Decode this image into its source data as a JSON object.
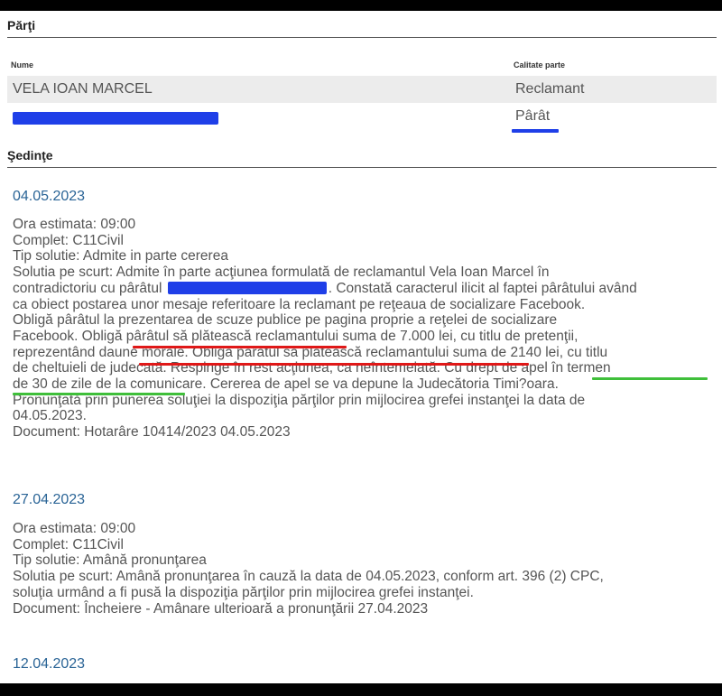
{
  "parti": {
    "title": "Părţi",
    "col_nume": "Nume",
    "col_calitate": "Calitate parte",
    "rows": [
      {
        "nume": "VELA IOAN MARCEL",
        "calitate": "Reclamant"
      },
      {
        "nume": "",
        "calitate": "Pârât"
      }
    ]
  },
  "sedinte": {
    "title": "Şedinţe",
    "items": [
      {
        "date": "04.05.2023",
        "lines": [
          "Ora estimata: 09:00",
          "Complet: C11Civil",
          "Tip solutie: Admite in parte cererea",
          "Solutia pe scurt: Admite în parte acţiunea formulată de reclamantul Vela Ioan Marcel în",
          "contradictoriu cu pârâtul",
          ". Constată caracterul ilicit al faptei pârâtului având",
          "ca obiect postarea unor mesaje referitoare la reclamant pe reţeaua de socializare Facebook.",
          "Obligă pârâtul la prezentarea de scuze publice pe pagina proprie a reţelei de socializare",
          "Facebook. Obligă pârâtul să plătească reclamantului suma de 7.000 lei, cu titlu de pretenţii,",
          "reprezentând daune morale. Obligă pârâtul să plătească reclamantului suma de 2140 lei, cu titlu",
          "de cheltuieli de judecată. Respinge în rest acţiunea, ca neîntemeiată. Cu drept de apel în termen",
          "de 30 de zile de la comunicare. Cererea de apel se va depune la Judecătoria Timi?oara.",
          "Pronunţată prin punerea soluţiei la dispoziţia părţilor prin mijlocirea grefei instanţei la data de",
          "04.05.2023.",
          "Document: Hotarâre  10414/2023  04.05.2023"
        ]
      },
      {
        "date": "27.04.2023",
        "lines": [
          "Ora estimata: 09:00",
          "Complet: C11Civil",
          "Tip solutie: Amână pronunţarea",
          "Solutia pe scurt: Amână pronunţarea în cauză la data de 04.05.2023, conform art. 396 (2) CPC,",
          "soluţia urmând a fi pusă la dispoziţia părţilor prin mijlocirea grefei instanţei.",
          "Document: Încheiere - Amânare ulterioară a pronunţării    27.04.2023"
        ]
      },
      {
        "date": "12.04.2023",
        "lines": []
      }
    ]
  },
  "colors": {
    "redaction": "#1f3fe8",
    "underline_red": "#e01818",
    "underline_green": "#3fbf3a",
    "date_link": "#2a6496"
  }
}
